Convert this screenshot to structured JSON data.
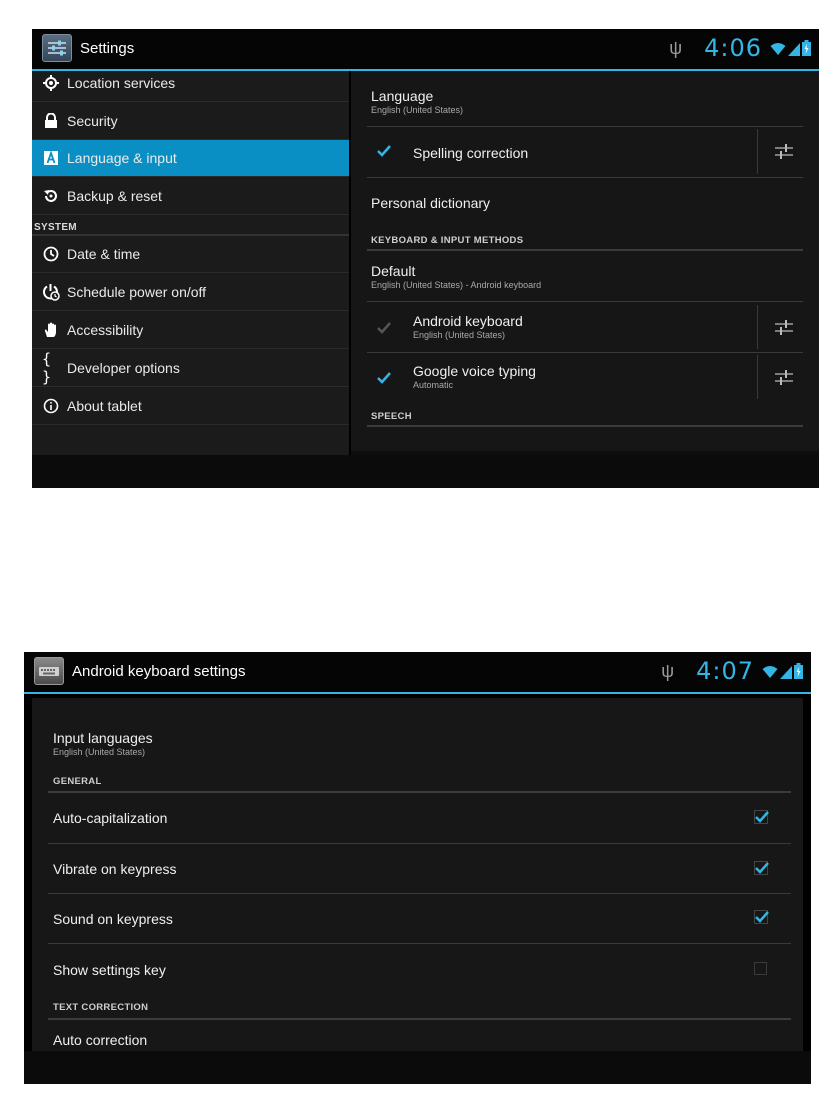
{
  "screen1": {
    "title": "Settings",
    "clock": "4:06",
    "left_items": [
      {
        "label": "Location services",
        "icon": "location-icon"
      },
      {
        "label": "Security",
        "icon": "lock-icon"
      },
      {
        "label": "Language & input",
        "icon": "language-icon",
        "selected": true
      },
      {
        "label": "Backup & reset",
        "icon": "backup-icon"
      }
    ],
    "system_header": "SYSTEM",
    "system_items": [
      {
        "label": "Date & time",
        "icon": "clock-icon"
      },
      {
        "label": "Schedule power on/off",
        "icon": "power-schedule-icon"
      },
      {
        "label": "Accessibility",
        "icon": "hand-icon"
      },
      {
        "label": "Developer options",
        "icon": "braces-icon"
      },
      {
        "label": "About tablet",
        "icon": "info-icon"
      }
    ],
    "right": {
      "language_title": "Language",
      "language_sub": "English (United States)",
      "spelling": "Spelling correction",
      "spelling_checked": true,
      "dictionary": "Personal dictionary",
      "kbd_header": "KEYBOARD & INPUT METHODS",
      "default_title": "Default",
      "default_sub": "English (United States) - Android keyboard",
      "android_kbd": "Android keyboard",
      "android_kbd_sub": "English (United States)",
      "android_kbd_checked": true,
      "voice": "Google voice typing",
      "voice_sub": "Automatic",
      "voice_checked": true,
      "speech_header": "SPEECH"
    }
  },
  "screen2": {
    "title": "Android keyboard settings",
    "clock": "4:07",
    "input_languages": "Input languages",
    "input_languages_sub": "English (United States)",
    "general_header": "GENERAL",
    "items": [
      {
        "label": "Auto-capitalization",
        "checked": true
      },
      {
        "label": "Vibrate on keypress",
        "checked": true
      },
      {
        "label": "Sound on keypress",
        "checked": true
      },
      {
        "label": "Show settings key",
        "checked": false
      }
    ],
    "textcorr_header": "TEXT CORRECTION",
    "auto_correction": "Auto correction"
  },
  "colors": {
    "accent": "#33b5e5",
    "selected": "#0a8fc4"
  }
}
